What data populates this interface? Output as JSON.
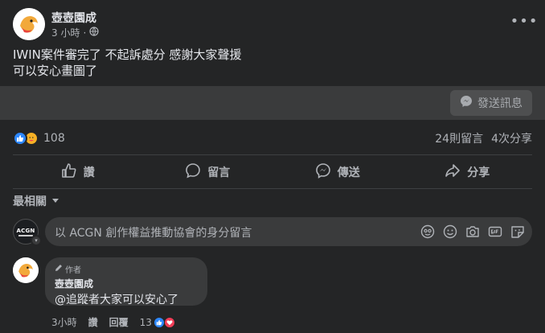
{
  "post": {
    "author": "壺壺園成",
    "time": "3 小時",
    "privacy_icon": "globe-icon",
    "more_icon": "more-options-icon",
    "text_line1": "IWIN案件審完了 不起訴處分 感謝大家聲援",
    "text_line2": "可以安心畫圖了"
  },
  "message_bar": {
    "send_label": "發送訊息",
    "icon": "messenger-icon"
  },
  "stats": {
    "reaction_count": "108",
    "comments": "24則留言",
    "shares": "4次分享",
    "reaction_icons": [
      "like-icon",
      "care-icon"
    ]
  },
  "actions": {
    "like": "讚",
    "comment": "留言",
    "send": "傳送",
    "share": "分享"
  },
  "sort": {
    "label": "最相關"
  },
  "compose": {
    "avatar_text": "ACGN",
    "placeholder": "以 ACGN 創作權益推動協會的身分留言",
    "icons": [
      "avatar-sticker-icon",
      "emoji-icon",
      "camera-icon",
      "gif-icon",
      "sticker-icon"
    ]
  },
  "comment": {
    "badge": "作者",
    "author": "壺壺園成",
    "text": "@追蹤者大家可以安心了",
    "time": "3小時",
    "like": "讚",
    "reply": "回覆",
    "reaction_count": "13"
  },
  "colors": {
    "background": "#242526",
    "surface": "#3a3b3c",
    "text_primary": "#e4e6eb",
    "text_secondary": "#b0b3b8",
    "like_blue": "#2d88ff",
    "love_red": "#f33e58",
    "care_yellow": "#f7b125"
  }
}
